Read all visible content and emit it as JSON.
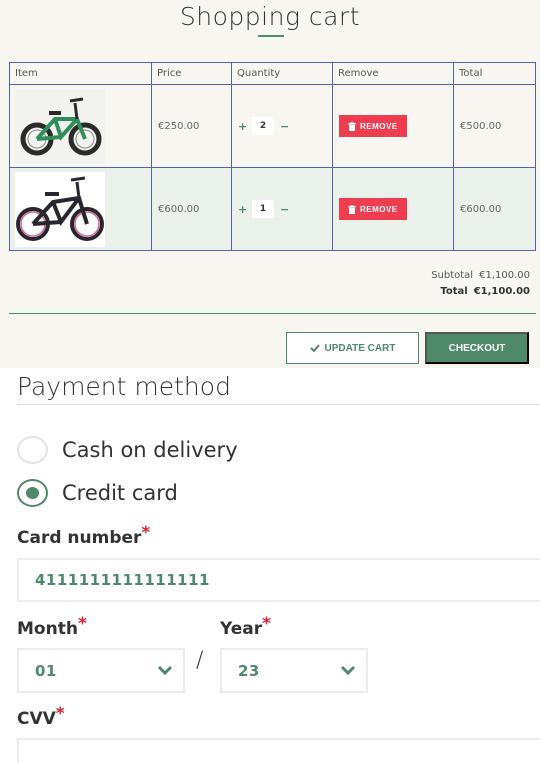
{
  "cart": {
    "title": "Shopping cart",
    "columns": [
      "Item",
      "Price",
      "Quantity",
      "Remove",
      "Total"
    ],
    "items": [
      {
        "name": "green-bmx-bike",
        "price": "€250.00",
        "quantity": "2",
        "remove_label": "REMOVE",
        "total": "€500.00",
        "bike_color": "#2f8f57"
      },
      {
        "name": "black-bmx-bike",
        "price": "€600.00",
        "quantity": "1",
        "remove_label": "REMOVE",
        "total": "€600.00",
        "bike_color": "#2a2630"
      }
    ],
    "qty_plus": "+",
    "qty_minus": "−",
    "subtotal_label": "Subtotal",
    "subtotal_value": "€1,100.00",
    "total_label": "Total",
    "total_value": "€1,100.00",
    "update_label": "UPDATE CART",
    "checkout_label": "CHECKOUT"
  },
  "payment": {
    "title": "Payment method",
    "options": [
      {
        "label": "Cash on delivery",
        "checked": false
      },
      {
        "label": "Credit card",
        "checked": true
      }
    ],
    "card_number_label": "Card number",
    "card_number_value": "4111111111111111",
    "month_label": "Month",
    "month_value": "01",
    "year_label": "Year",
    "year_value": "23",
    "separator": "/",
    "cvv_label": "CVV",
    "cvv_value": "",
    "required_mark": "*"
  },
  "colors": {
    "accent": "#4e8a6a",
    "remove_red": "#ef3d50",
    "required_red": "#e0202e",
    "table_border": "#5561b4"
  }
}
